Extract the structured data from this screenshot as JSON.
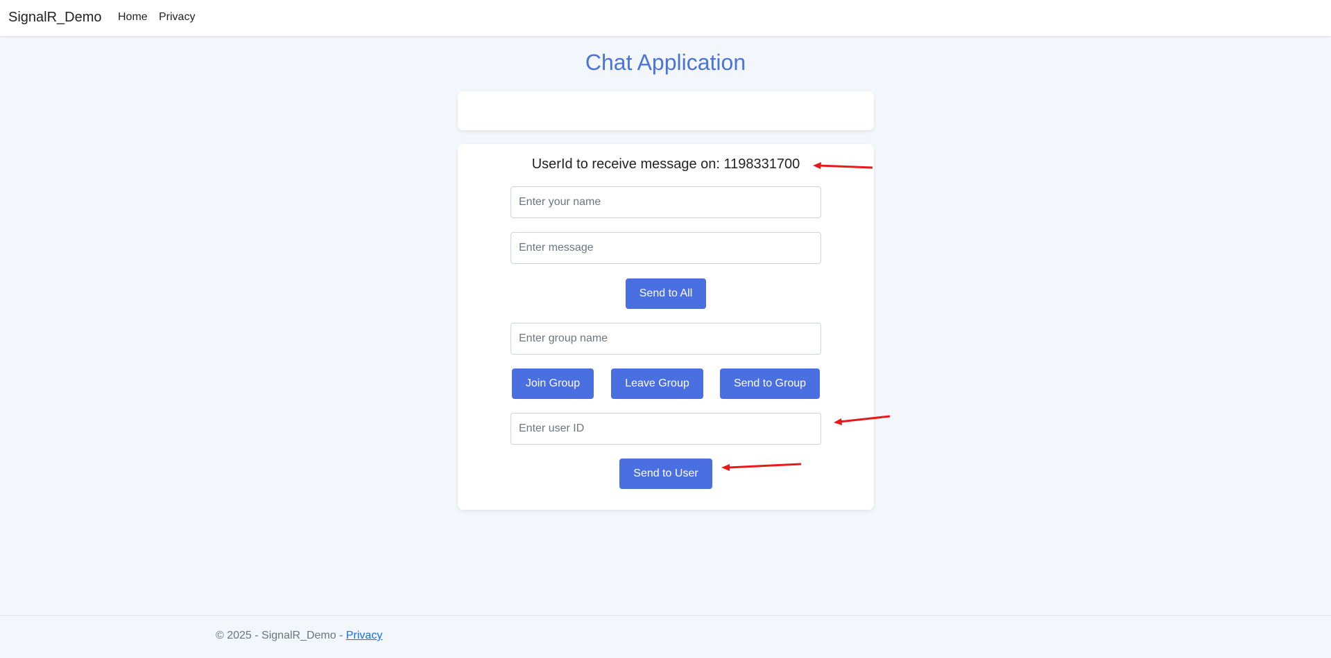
{
  "navbar": {
    "brand": "SignalR_Demo",
    "links": [
      "Home",
      "Privacy"
    ]
  },
  "main": {
    "title": "Chat Application",
    "userid_prefix": "UserId to receive message on: ",
    "userid_value": "1198331700",
    "userid_line": "UserId to receive message on: 1198331700",
    "inputs": {
      "name_placeholder": "Enter your name",
      "message_placeholder": "Enter message",
      "group_placeholder": "Enter group name",
      "user_placeholder": "Enter user ID"
    },
    "buttons": {
      "send_all": "Send to All",
      "join_group": "Join Group",
      "leave_group": "Leave Group",
      "send_group": "Send to Group",
      "send_user": "Send to User"
    }
  },
  "footer": {
    "text": "© 2025 - SignalR_Demo - ",
    "link": "Privacy"
  },
  "colors": {
    "accent": "#4a6fe0",
    "title": "#4a74d8",
    "annotation": "#e8191a",
    "background": "#f3f6fa"
  }
}
